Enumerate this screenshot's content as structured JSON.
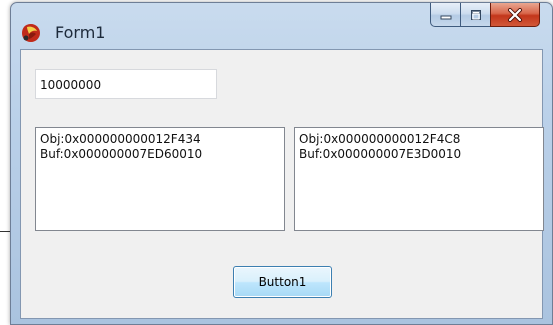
{
  "window": {
    "title": "Form1",
    "icons": {
      "app": "delphi-app-icon",
      "minimize": "minimize-icon",
      "maximize": "maximize-icon",
      "close": "close-icon"
    }
  },
  "form": {
    "edit_value": "10000000",
    "memo_left": {
      "lines": [
        "Obj:0x000000000012F434",
        "Buf:0x000000007ED60010"
      ]
    },
    "memo_right": {
      "lines": [
        "Obj:0x000000000012F4C8",
        "Buf:0x000000007E3D0010"
      ]
    },
    "button_label": "Button1"
  },
  "colors": {
    "close_button": "#c2361b",
    "frame": "#bcd2ea",
    "button_face": "#bee6fd"
  }
}
